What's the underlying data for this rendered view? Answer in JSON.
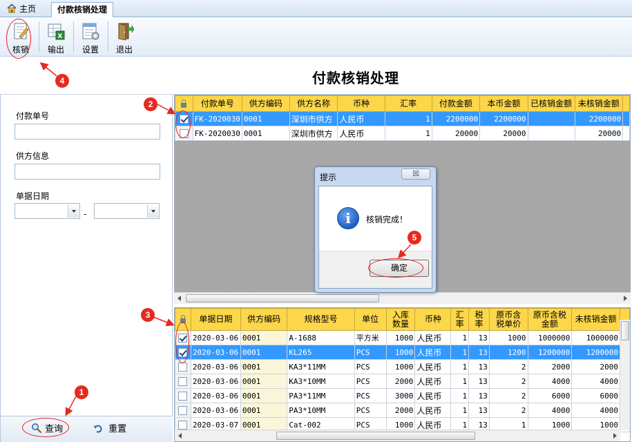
{
  "tabs": {
    "home": "主页",
    "active": "付款核销处理"
  },
  "toolbar": {
    "verify": "核销",
    "export": "输出",
    "settings": "设置",
    "exit": "退出"
  },
  "page_title": "付款核销处理",
  "filters": {
    "payment_no_label": "付款单号",
    "supplier_label": "供方信息",
    "date_label": "单据日期",
    "date_sep": "-",
    "query": "查询",
    "reset": "重置"
  },
  "top_grid": {
    "columns": [
      "付款单号",
      "供方编码",
      "供方名称",
      "币种",
      "汇率",
      "付款金额",
      "本币金额",
      "已核销金额",
      "未核销金额"
    ],
    "rows": [
      {
        "checked": true,
        "selected": true,
        "cells": [
          "FK-2020030",
          "0001",
          "深圳市供方",
          "人民币",
          "1",
          "2200000",
          "2200000",
          "",
          "2200000"
        ]
      },
      {
        "checked": false,
        "selected": false,
        "cells": [
          "FK-2020030",
          "0001",
          "深圳市供方",
          "人民币",
          "1",
          "20000",
          "20000",
          "",
          "20000"
        ]
      }
    ]
  },
  "bottom_grid": {
    "columns": [
      "单据日期",
      "供方编码",
      "规格型号",
      "单位",
      "入库\n数量",
      "币种",
      "汇\n率",
      "税\n率",
      "原币含\n税单价",
      "原币含税\n金额",
      "未核销金额"
    ],
    "rows": [
      {
        "checked": true,
        "selected": false,
        "cells": [
          "2020-03-06",
          "0001",
          "A-1688",
          "平方米",
          "1000",
          "人民币",
          "1",
          "13",
          "1000",
          "1000000",
          "1000000"
        ]
      },
      {
        "checked": true,
        "selected": true,
        "cells": [
          "2020-03-06",
          "0001",
          "KL265",
          "PCS",
          "1000",
          "人民币",
          "1",
          "13",
          "1200",
          "1200000",
          "1200000"
        ]
      },
      {
        "checked": false,
        "selected": false,
        "cells": [
          "2020-03-06",
          "0001",
          "KA3*11MM",
          "PCS",
          "1000",
          "人民币",
          "1",
          "13",
          "2",
          "2000",
          "2000"
        ]
      },
      {
        "checked": false,
        "selected": false,
        "cells": [
          "2020-03-06",
          "0001",
          "KA3*10MM",
          "PCS",
          "2000",
          "人民币",
          "1",
          "13",
          "2",
          "4000",
          "4000"
        ]
      },
      {
        "checked": false,
        "selected": false,
        "cells": [
          "2020-03-06",
          "0001",
          "PA3*11MM",
          "PCS",
          "3000",
          "人民币",
          "1",
          "13",
          "2",
          "6000",
          "6000"
        ]
      },
      {
        "checked": false,
        "selected": false,
        "cells": [
          "2020-03-06",
          "0001",
          "PA3*10MM",
          "PCS",
          "2000",
          "人民币",
          "1",
          "13",
          "2",
          "4000",
          "4000"
        ]
      },
      {
        "checked": false,
        "selected": false,
        "cells": [
          "2020-03-07",
          "0001",
          "Cat-002",
          "PCS",
          "1000",
          "人民币",
          "1",
          "13",
          "1",
          "1000",
          "1000"
        ]
      }
    ]
  },
  "dialog": {
    "title": "提示",
    "message": "核销完成！",
    "ok": "确定",
    "close": "☒"
  },
  "annotations": [
    "1",
    "2",
    "3",
    "4",
    "5"
  ],
  "colors": {
    "accent_header": "#fdd74a",
    "selection": "#3399ff",
    "annotation": "#e52a20"
  }
}
